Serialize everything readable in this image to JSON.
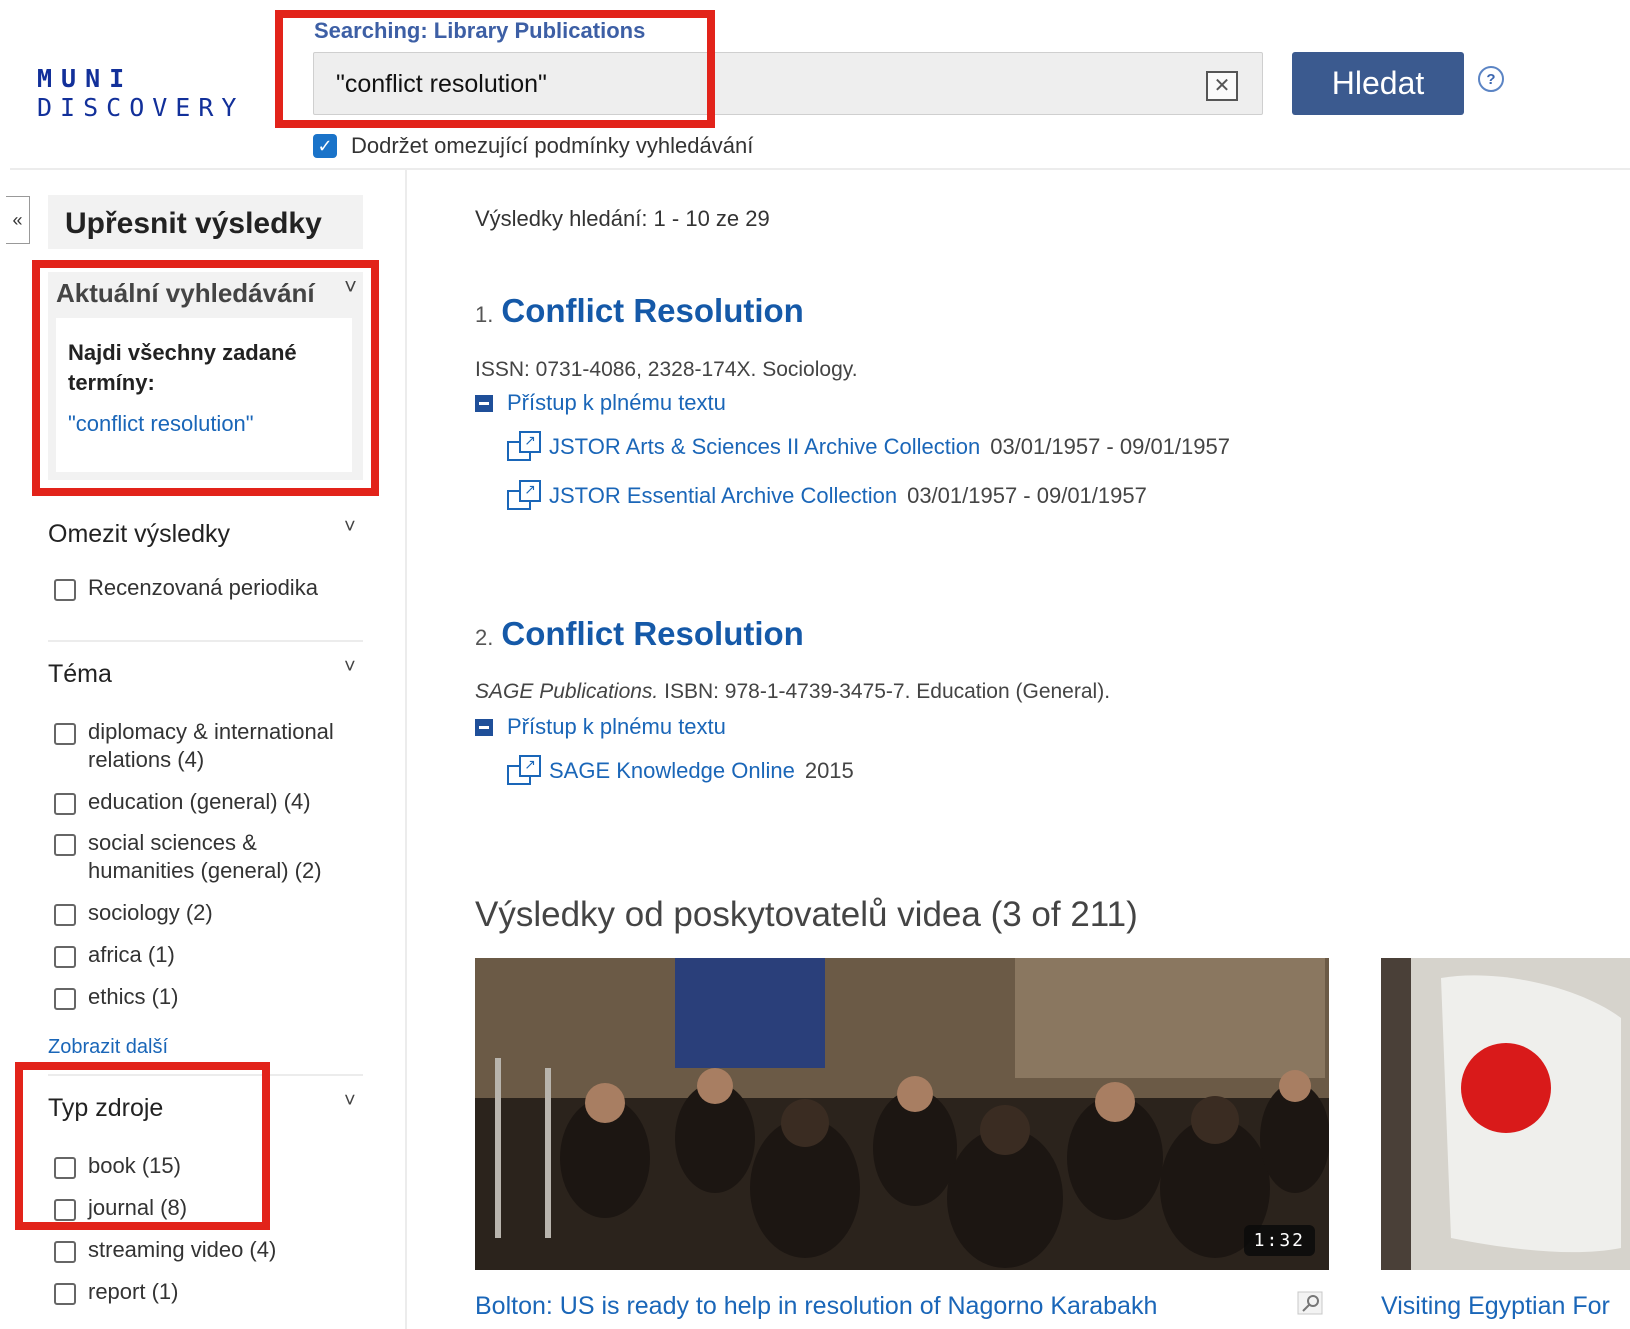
{
  "header": {
    "logo_line1": "MUNI",
    "logo_line2": "DISCOVERY",
    "scope_label": "Searching: Library Publications",
    "search_value": "\"conflict resolution\"",
    "search_button": "Hledat",
    "help_icon": "?",
    "keep_filters_label": "Dodržet omezující podmínky vyhledávání",
    "keep_filters_checked": true
  },
  "sidebar": {
    "collapse_glyph": "«",
    "title": "Upřesnit výsledky",
    "current_search": {
      "title": "Aktuální vyhledávání",
      "label": "Najdi všechny zadané termíny:",
      "term": "\"conflict resolution\""
    },
    "facets": [
      {
        "title": "Omezit výsledky",
        "items": [
          "Recenzovaná periodika"
        ]
      },
      {
        "title": "Téma",
        "items": [
          "diplomacy & international relations (4)",
          "education (general) (4)",
          "social sciences & humanities (general) (2)",
          "sociology (2)",
          "africa (1)",
          "ethics (1)"
        ],
        "show_more": "Zobrazit další"
      },
      {
        "title": "Typ zdroje",
        "items": [
          "book (15)",
          "journal (8)",
          "streaming video (4)",
          "report (1)"
        ]
      }
    ]
  },
  "results": {
    "count_text": "Výsledky hledání: 1 - 10 ze 29",
    "fulltext_label": "Přístup k plnému textu",
    "items": [
      {
        "number": "1.",
        "title": "Conflict Resolution",
        "publisher": "",
        "meta": "ISSN: 0731-4086, 2328-174X. Sociology.",
        "links": [
          {
            "source": "JSTOR Arts & Sciences II Archive Collection",
            "dates": "03/01/1957 - 09/01/1957"
          },
          {
            "source": "JSTOR Essential Archive Collection",
            "dates": "03/01/1957 - 09/01/1957"
          }
        ]
      },
      {
        "number": "2.",
        "title": "Conflict Resolution",
        "publisher": "SAGE Publications.",
        "meta": "ISBN: 978-1-4739-3475-7. Education (General).",
        "links": [
          {
            "source": "SAGE Knowledge Online",
            "dates": "2015"
          }
        ]
      }
    ]
  },
  "videos": {
    "heading": "Výsledky od poskytovatelů videa (3 of 211)",
    "items": [
      {
        "title": "Bolton: US is ready to help in resolution of Nagorno Karabakh",
        "duration": "1:32"
      },
      {
        "title": "Visiting Egyptian For"
      }
    ]
  },
  "colors": {
    "accent": "#1559a8",
    "button": "#3b5a8f",
    "highlight_box": "#e2231a"
  }
}
